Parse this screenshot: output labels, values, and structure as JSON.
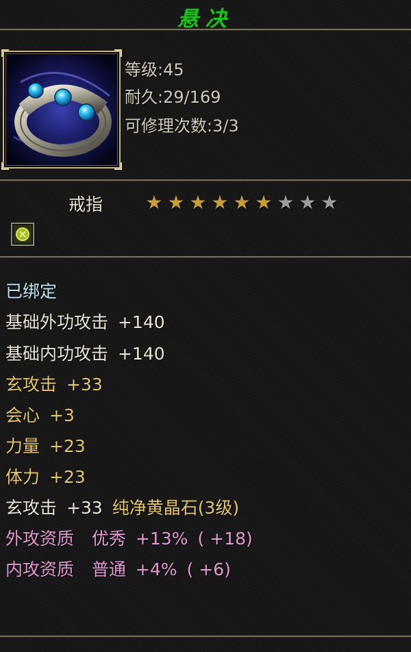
{
  "item": {
    "name": "悬决",
    "icon": "blue-gem-ring-icon",
    "stats": [
      {
        "label": "等级",
        "value": "45"
      },
      {
        "label": "耐久",
        "value": "29/169"
      },
      {
        "label": "可修理次数",
        "value": "3/3"
      }
    ],
    "type": "戒指",
    "stars": {
      "filled": 6,
      "total": 9
    },
    "gem_slot_icon": "yellow-gem-slot-icon",
    "bound": "已绑定",
    "attributes": [
      {
        "name": "基础外功攻击",
        "value": "+140"
      },
      {
        "name": "基础内功攻击",
        "value": "+140"
      },
      {
        "name": "玄攻击",
        "value": "+33"
      },
      {
        "name": "会心",
        "value": "+3"
      },
      {
        "name": "力量",
        "value": "+23"
      },
      {
        "name": "体力",
        "value": "+23"
      }
    ],
    "gem_bonus": {
      "name": "玄攻击",
      "value": "+33",
      "gem": "纯净黄晶石(3级)"
    },
    "qualities": [
      {
        "name": "外攻资质",
        "grade": "优秀",
        "percent": "+13%",
        "bonus": "( +18)"
      },
      {
        "name": "内攻资质",
        "grade": "普通",
        "percent": "+4%",
        "bonus": "( +6)"
      }
    ]
  },
  "colors": {
    "title": "#1fc01f",
    "bound": "#bfe6ee",
    "base_attr": "#eae5d6",
    "bonus_attr": "#e6c66f",
    "quality": "#e39ad3",
    "star_on": "#c79e3d",
    "star_off": "#9d9d9d"
  }
}
